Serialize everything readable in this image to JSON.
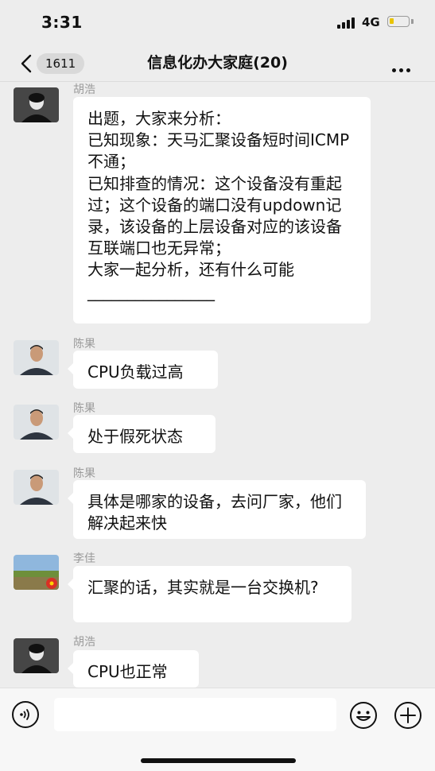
{
  "status_bar": {
    "time": "3:31",
    "network": "4G",
    "battery_color": "#e9c400"
  },
  "header": {
    "back_icon": "chevron-left-icon",
    "unread_count": "1611",
    "title": "信息化办大家庭(20)",
    "more_icon": "more-dots-icon"
  },
  "messages": [
    {
      "sender": "胡浩",
      "text": "出题，大家来分析：\n已知现象：天马汇聚设备短时间ICMP不通；\n已知排查的情况：这个设备没有重起过；这个设备的端口没有updown记录，该设备的上层设备对应的该设备互联端口也无异常；\n大家一起分析，还有什么可能 ________________"
    },
    {
      "sender": "陈果",
      "text": "CPU负载过高"
    },
    {
      "sender": "陈果",
      "text": "处于假死状态"
    },
    {
      "sender": "陈果",
      "text": "具体是哪家的设备，去问厂家，他们解决起来快"
    },
    {
      "sender": "李佳",
      "text": "汇聚的话，其实就是一台交换机?"
    },
    {
      "sender": "胡浩",
      "text": "CPU也正常"
    }
  ],
  "input_bar": {
    "voice_icon": "voice-icon",
    "text_value": "",
    "emoji_icon": "emoji-icon",
    "plus_icon": "plus-icon"
  },
  "colors": {
    "background": "#ededed",
    "bubble": "#ffffff",
    "sender_name": "#9a9a9a"
  }
}
